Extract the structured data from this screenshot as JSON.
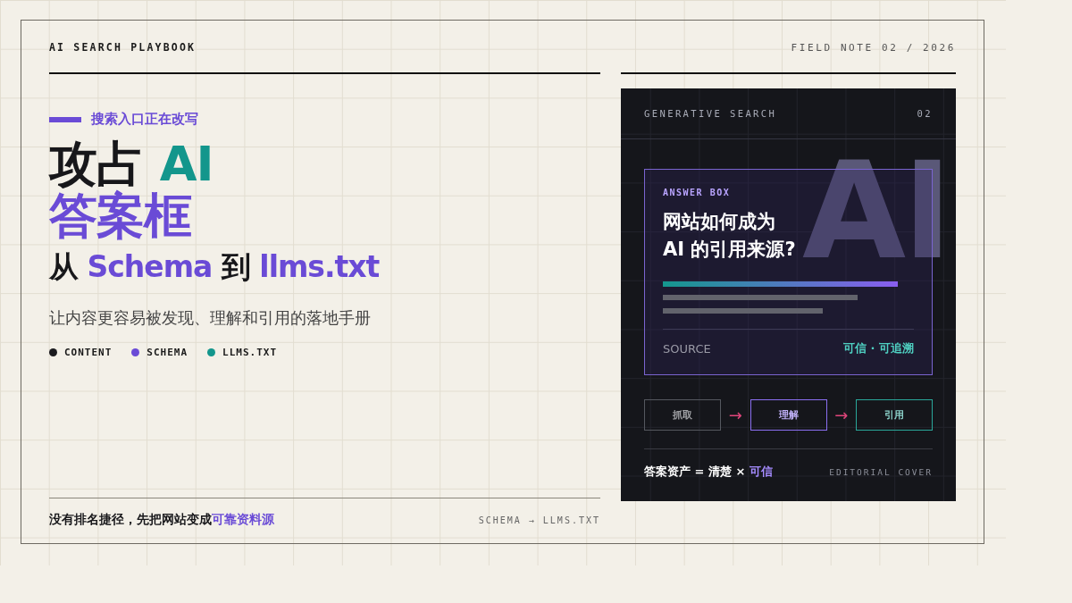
{
  "header": {
    "brand": "AI SEARCH PLAYBOOK",
    "note": "FIELD NOTE 02 / 2026"
  },
  "hero": {
    "kicker": "搜索入口正在改写",
    "title_lines": [
      [
        {
          "text": "攻占 ",
          "kind": "ink"
        },
        {
          "text": "AI",
          "kind": "teal"
        }
      ],
      [
        {
          "text": "答案框",
          "kind": "purple"
        }
      ]
    ],
    "subtitle": [
      {
        "text": "从 ",
        "kind": "ink"
      },
      {
        "text": "Schema",
        "kind": "purple"
      },
      {
        "text": " 到 ",
        "kind": "ink"
      },
      {
        "text": "llms.txt",
        "kind": "purple"
      }
    ],
    "description": "让内容更容易被发现、理解和引用的落地手册",
    "legend": [
      {
        "label": "CONTENT",
        "color": "#1b1b1f"
      },
      {
        "label": "SCHEMA",
        "color": "#6a4bd6"
      },
      {
        "label": "LLMS.TXT",
        "color": "#13968c"
      }
    ]
  },
  "footer": {
    "tagline": [
      {
        "text": "没有排名捷径，先把网站变成",
        "kind": "ink"
      },
      {
        "text": "可靠资料源",
        "kind": "purple"
      }
    ],
    "path": "SCHEMA → LLMS.TXT"
  },
  "card": {
    "watermark": "AI",
    "label": "GENERATIVE SEARCH",
    "number": "02",
    "answer_box": {
      "label": "ANSWER BOX",
      "question_lines": [
        "网站如何成为",
        "AI 的引用来源?"
      ],
      "source_label": "SOURCE",
      "source_value": "可信 · 可追溯"
    },
    "steps": [
      {
        "label": "抓取",
        "color": "#55585f"
      },
      {
        "label": "理解",
        "color": "#8a6ff0"
      },
      {
        "label": "引用",
        "color": "#2aa79a"
      }
    ],
    "arrow": "→",
    "formula": [
      {
        "text": "答案资产 = 清楚 × ",
        "kind": "white"
      },
      {
        "text": "可信",
        "kind": "lavender"
      }
    ],
    "caption": "EDITORIAL COVER"
  }
}
